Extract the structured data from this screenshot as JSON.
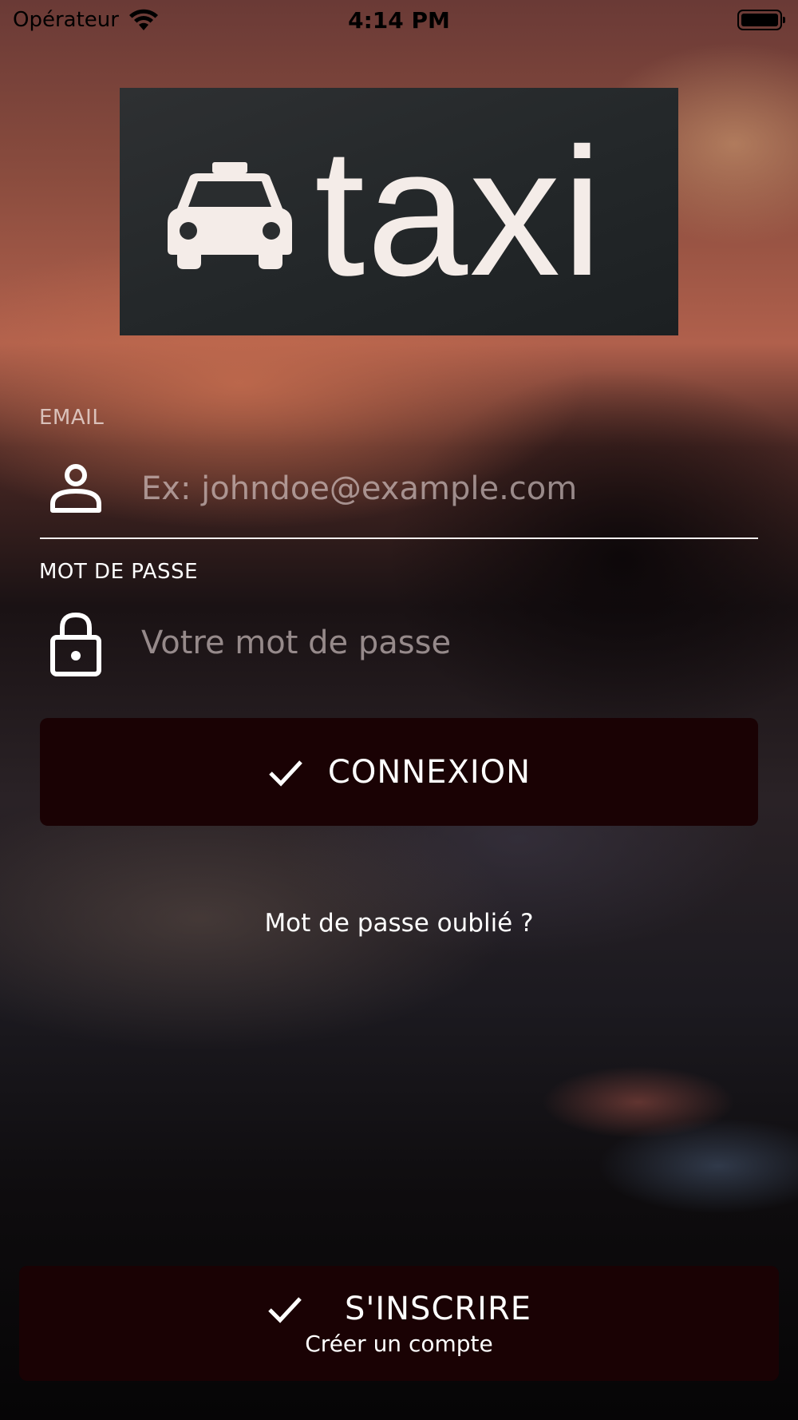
{
  "status_bar": {
    "carrier": "Opérateur",
    "time": "4:14 PM",
    "icons": [
      "wifi-icon",
      "battery-icon"
    ]
  },
  "logo": {
    "text": "taxi",
    "icon": "taxi-car-icon"
  },
  "form": {
    "email": {
      "label": "EMAIL",
      "placeholder": "Ex: johndoe@example.com",
      "value": "",
      "icon": "person-icon"
    },
    "password": {
      "label": "MOT DE PASSE",
      "placeholder": "Votre mot de passe",
      "value": "",
      "icon": "lock-icon"
    },
    "login_button": {
      "label": "CONNEXION",
      "icon": "check-icon"
    },
    "forgot_password": "Mot de passe oublié ?"
  },
  "signup_button": {
    "label": "S'INSCRIRE",
    "sublabel": "Créer un compte",
    "icon": "check-icon"
  },
  "colors": {
    "button_background": "#1a0204",
    "text": "#ffffff",
    "logo_background": "#24282a"
  }
}
